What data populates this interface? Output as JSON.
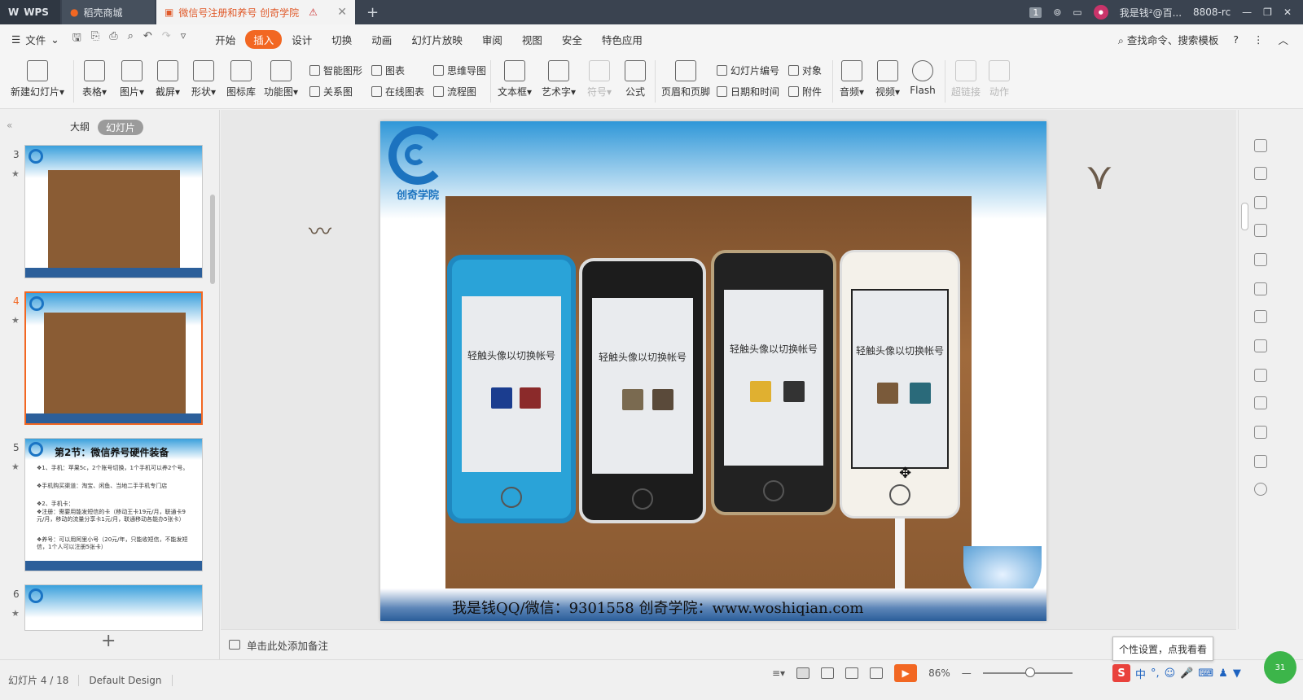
{
  "titlebar": {
    "tabs": [
      {
        "label": "WPS"
      },
      {
        "label": "稻壳商城"
      },
      {
        "label": "微信号注册和养号  创奇学院"
      }
    ],
    "page_counter": "1",
    "username": "我是钱²@百...",
    "room": "8808-rc"
  },
  "menubar": {
    "file": "文件",
    "items": [
      "开始",
      "插入",
      "设计",
      "切换",
      "动画",
      "幻灯片放映",
      "审阅",
      "视图",
      "安全",
      "特色应用"
    ],
    "active": "插入",
    "search": "查找命令、搜索模板"
  },
  "ribbon": {
    "new_slide": "新建幻灯片",
    "table": "表格",
    "picture": "图片",
    "screenshot": "截屏",
    "shape": "形状",
    "icon_lib": "图标库",
    "func_chart": "功能图",
    "smart_shape": "智能图形",
    "chart": "图表",
    "mind_map": "思维导图",
    "relation": "关系图",
    "online_chart": "在线图表",
    "flow_chart": "流程图",
    "textbox": "文本框",
    "art_text": "艺术字",
    "symbol": "符号",
    "formula": "公式",
    "header_footer": "页眉和页脚",
    "slide_number": "幻灯片编号",
    "object": "对象",
    "date_time": "日期和时间",
    "attachment": "附件",
    "audio": "音频",
    "video": "视频",
    "flash": "Flash",
    "hyperlink": "超链接",
    "action": "动作"
  },
  "leftpanel": {
    "tab_outline": "大纲",
    "tab_slides": "幻灯片",
    "slides": [
      {
        "num": "3"
      },
      {
        "num": "4"
      },
      {
        "num": "5",
        "title": "第2节：微信养号硬件装备",
        "lines": [
          "❖1、手机：苹果5c，2个账号切换，1个手机可以养2个号。",
          "❖手机购买渠道：淘宝、闲鱼、当地二手手机专门店",
          "❖2、手机卡：",
          "❖注册：需要用能发短信的卡（移动王卡19元/月，联通卡9元/月，移动的流量分享卡1元/月，联通移动各能办5张卡）",
          "❖养号：可以用阿里小号（20元/年，只能收短信，不能发短信，1个人可以注册5张卡）"
        ]
      },
      {
        "num": "6"
      }
    ]
  },
  "slide": {
    "logo_text": "创奇学院",
    "screen_title": "轻触头像以切换帐号",
    "footer": "我是钱QQ/微信：9301558    创奇学院：www.woshiqian.com"
  },
  "notes": {
    "placeholder": "单击此处添加备注"
  },
  "statusbar": {
    "slide_pos": "幻灯片 4 / 18",
    "theme": "Default Design",
    "zoom": "86%",
    "tooltip": "个性设置，点我看看",
    "ime": "中",
    "badge": "31"
  },
  "colors": {
    "accent": "#f26722",
    "titlebar": "#3a4350"
  }
}
